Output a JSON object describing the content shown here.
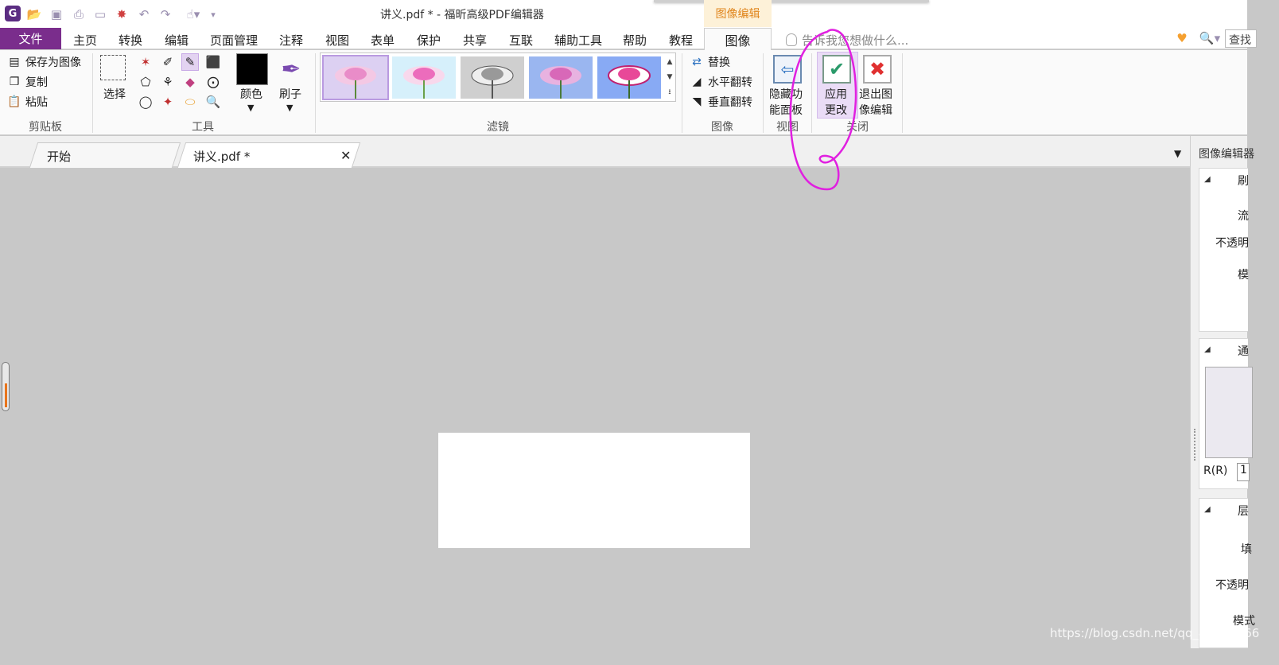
{
  "window": {
    "title": "讲义.pdf * - 福昕高级PDF编辑器",
    "context_tab": "图像编辑"
  },
  "menu": {
    "file": "文件",
    "items": [
      "主页",
      "转换",
      "编辑",
      "页面管理",
      "注释",
      "视图",
      "表单",
      "保护",
      "共享",
      "互联",
      "辅助工具",
      "帮助",
      "教程"
    ],
    "active_tab": "图像",
    "tell_me": "告诉我您想做什么...",
    "search": "查找"
  },
  "ribbon": {
    "clipboard": {
      "save_as_image": "保存为图像",
      "copy": "复制",
      "paste": "粘贴",
      "label": "剪贴板"
    },
    "tools": {
      "select": "选择",
      "label": "工具"
    },
    "color": {
      "label": "颜色",
      "swatch": "#000000"
    },
    "brush": {
      "label": "刷子"
    },
    "filters": {
      "label": "滤镜"
    },
    "image": {
      "replace": "替换",
      "flip_horizontal": "水平翻转",
      "flip_vertical": "垂直翻转",
      "label": "图像"
    },
    "view": {
      "hide_panel_line1": "隐藏功",
      "hide_panel_line2": "能面板",
      "label": "视图"
    },
    "close": {
      "apply_line1": "应用",
      "apply_line2": "更改",
      "exit_line1": "退出图",
      "exit_line2": "像编辑",
      "label": "关闭"
    }
  },
  "tabs": {
    "start": "开始",
    "document": "讲义.pdf *"
  },
  "right_panel": {
    "title": "图像编辑器",
    "sections": [
      {
        "heading": "刷",
        "rows": [
          "流",
          "不透明",
          "模"
        ]
      },
      {
        "heading": "通",
        "rows": []
      },
      {
        "heading": "层",
        "rows": [
          "填",
          "不透明",
          "模式"
        ]
      }
    ],
    "r_label": "R(R)",
    "r_value": "1"
  },
  "watermark": "https://blog.csdn.net/qq_40306266",
  "colors": {
    "brand_purple": "#7a2d8c",
    "annotation": "#e020e0",
    "context_orange": "#e0851c"
  }
}
